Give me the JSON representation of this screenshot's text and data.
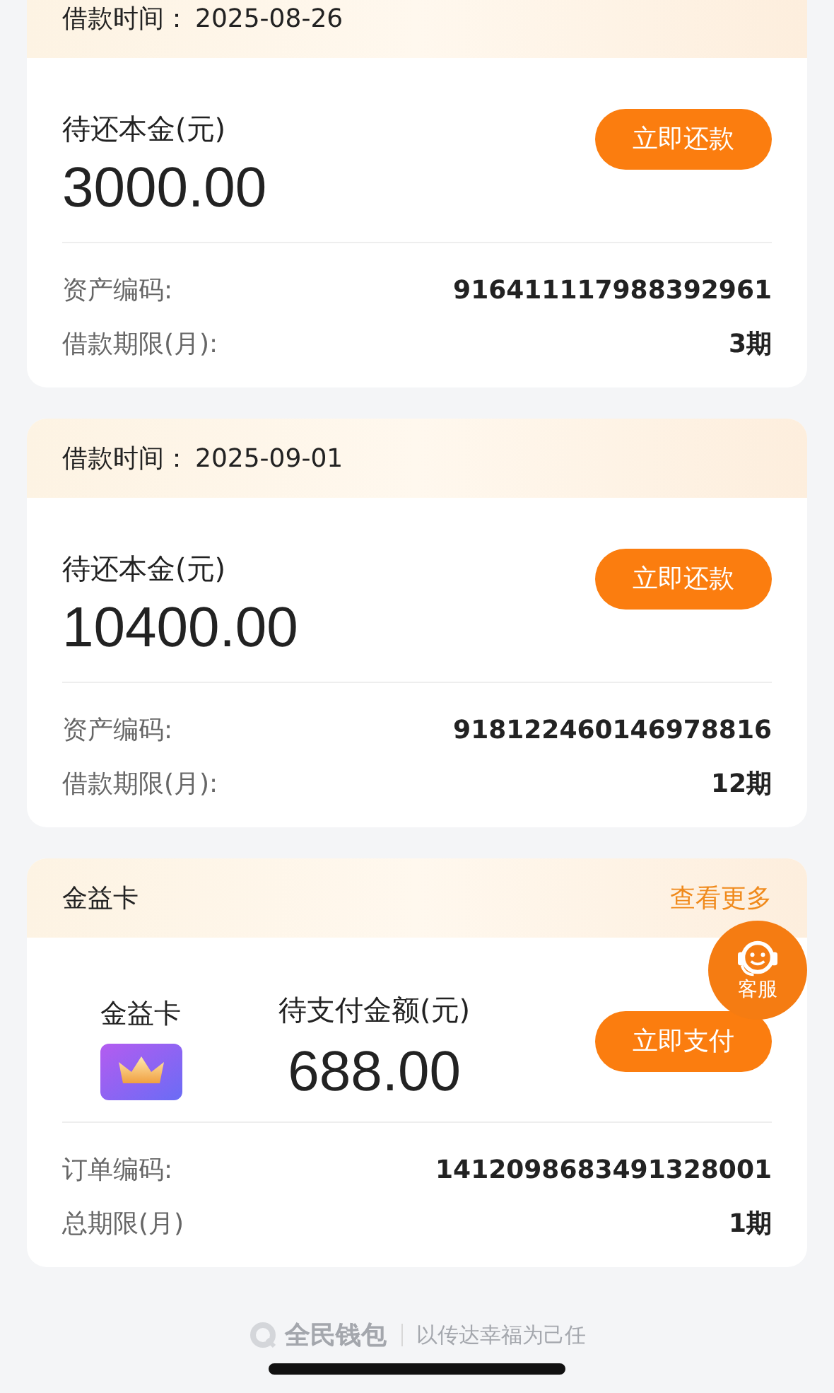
{
  "loans": [
    {
      "date_label": "借款时间：",
      "date": "2025-08-26",
      "amount_label": "待还本金(元)",
      "amount": "3000.00",
      "button": "立即还款",
      "rows": [
        {
          "label": "资产编码:",
          "value": "916411117988392961"
        },
        {
          "label": "借款期限(月):",
          "value": "3期"
        }
      ]
    },
    {
      "date_label": "借款时间：",
      "date": "2025-09-01",
      "amount_label": "待还本金(元)",
      "amount": "10400.00",
      "button": "立即还款",
      "rows": [
        {
          "label": "资产编码:",
          "value": "918122460146978816"
        },
        {
          "label": "借款期限(月):",
          "value": "12期"
        }
      ]
    }
  ],
  "benefit": {
    "title": "金益卡",
    "more": "查看更多",
    "card_name": "金益卡",
    "amount_label": "待支付金额(元)",
    "amount": "688.00",
    "button": "立即支付",
    "rows": [
      {
        "label": "订单编码:",
        "value": "1412098683491328001"
      },
      {
        "label": "总期限(月)",
        "value": "1期"
      }
    ]
  },
  "service": {
    "label": "客服"
  },
  "footer": {
    "brand": "全民钱包",
    "slogan": "以传达幸福为己任"
  }
}
